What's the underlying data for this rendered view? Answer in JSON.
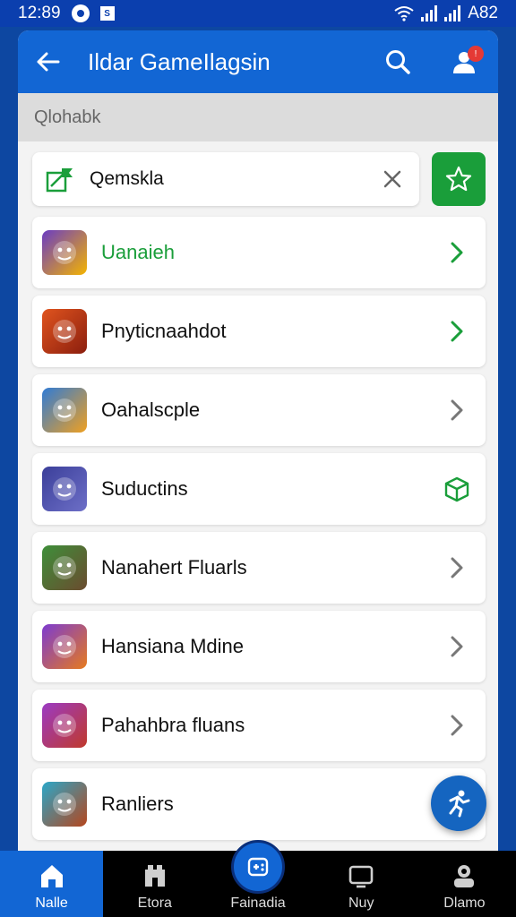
{
  "status_bar": {
    "time": "12:89",
    "sim_label": "S",
    "battery": "A82"
  },
  "app_bar": {
    "title": "Ildar GameIlagsin"
  },
  "subheader": {
    "text": "Qlohabk"
  },
  "search": {
    "value": "Qemskla",
    "placeholder": ""
  },
  "games": [
    {
      "label": "Uanaieh",
      "accent": "#1a9e3a",
      "trailing": "chevron-right-icon",
      "trailing_color": "#1a9e3a",
      "icon_colors": [
        "#6a3cc4",
        "#f4b400"
      ]
    },
    {
      "label": "Pnyticnaahdot",
      "accent": "#111111",
      "trailing": "chevron-right-icon",
      "trailing_color": "#1a9e3a",
      "icon_colors": [
        "#e0541e",
        "#8b1e0e"
      ]
    },
    {
      "label": "Oahalscple",
      "accent": "#111111",
      "trailing": "chevron-right-icon",
      "trailing_color": "#777777",
      "icon_colors": [
        "#2f7bd6",
        "#f0a020"
      ]
    },
    {
      "label": "Suductins",
      "accent": "#111111",
      "trailing": "cube-icon",
      "trailing_color": "#1a9e3a",
      "icon_colors": [
        "#3b3f9a",
        "#6d6fc7"
      ]
    },
    {
      "label": "Nanahert Fluarls",
      "accent": "#111111",
      "trailing": "chevron-right-icon",
      "trailing_color": "#777777",
      "icon_colors": [
        "#3e8f3a",
        "#6b4b2f"
      ]
    },
    {
      "label": "Hansiana Mdine",
      "accent": "#111111",
      "trailing": "chevron-right-icon",
      "trailing_color": "#777777",
      "icon_colors": [
        "#7c3bd1",
        "#e67a1e"
      ]
    },
    {
      "label": "Pahahbra fluans",
      "accent": "#111111",
      "trailing": "chevron-right-icon",
      "trailing_color": "#777777",
      "icon_colors": [
        "#9b3bc4",
        "#c0392b"
      ]
    },
    {
      "label": "Ranliers",
      "accent": "#111111",
      "trailing": "",
      "trailing_color": "#777777",
      "icon_colors": [
        "#2aa7c9",
        "#b5461d"
      ]
    }
  ],
  "bottom_nav": [
    {
      "label": "Nalle",
      "icon": "home-icon",
      "active": true
    },
    {
      "label": "Etora",
      "icon": "store-icon",
      "active": false
    },
    {
      "label": "Fainadia",
      "icon": "gamepad-icon",
      "active": false
    },
    {
      "label": "Nuy",
      "icon": "screen-icon",
      "active": false
    },
    {
      "label": "Dlamo",
      "icon": "profile-icon",
      "active": false
    }
  ],
  "colors": {
    "primary": "#1266d4",
    "success": "#1a9e3a",
    "notification": "#e53935"
  }
}
